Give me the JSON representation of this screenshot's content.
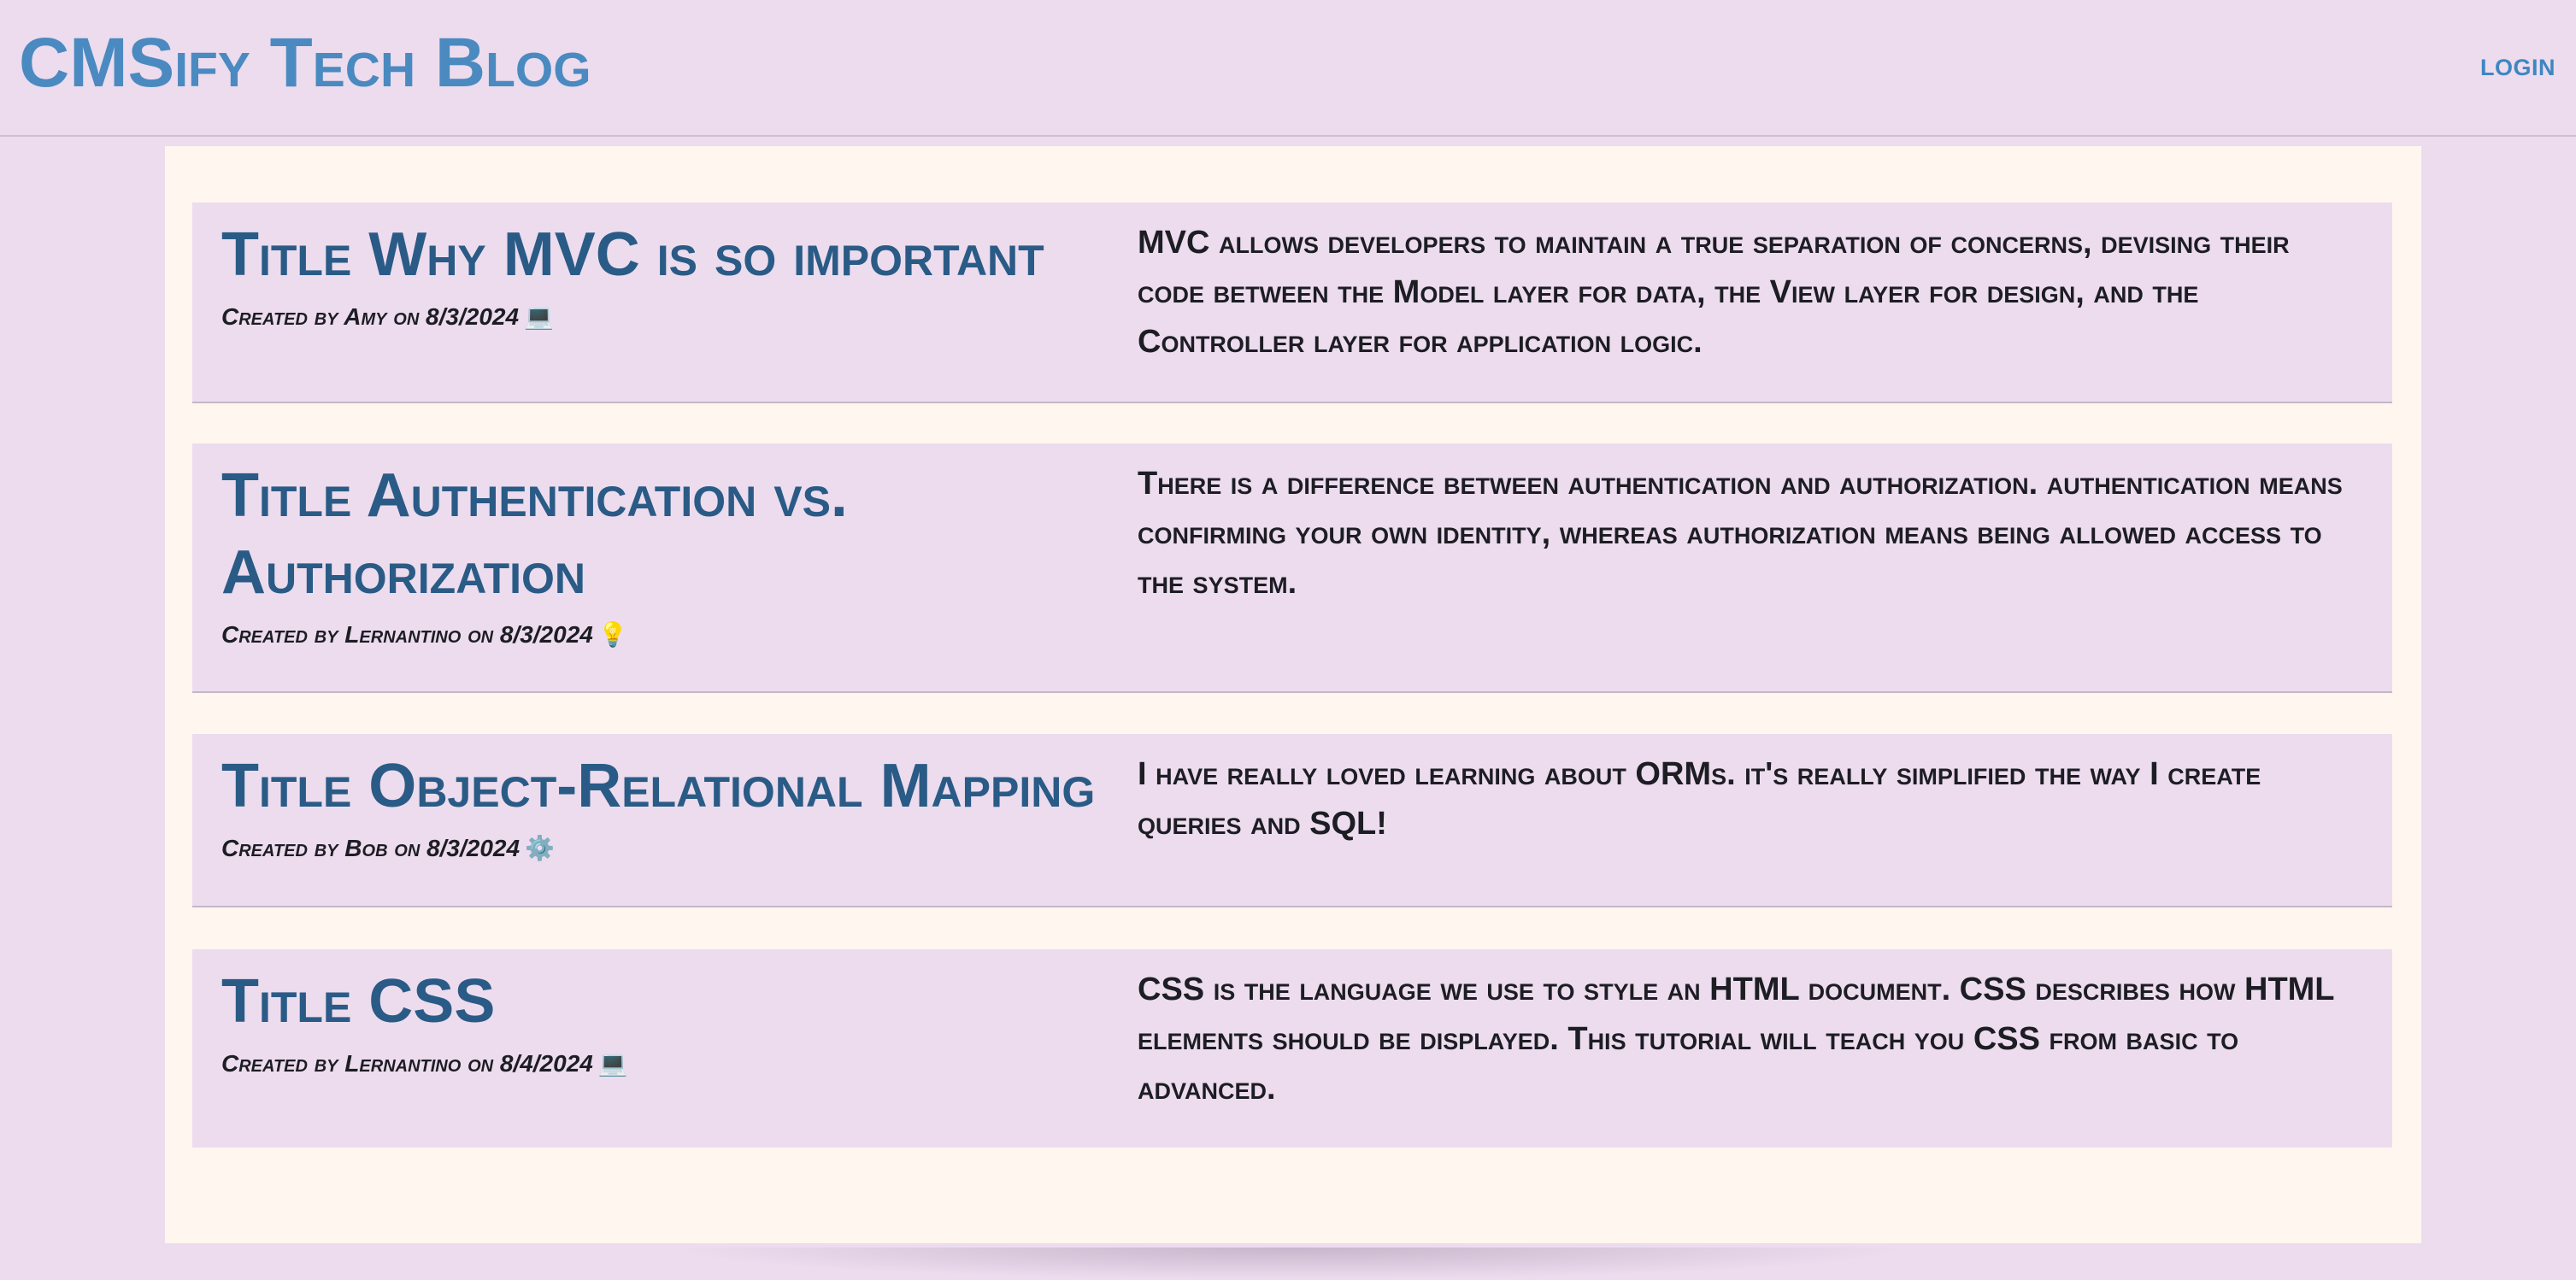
{
  "header": {
    "site_title": "CMSify Tech Blog",
    "login_label": "LOGIN"
  },
  "posts": [
    {
      "title": "Title Why MVC is so important",
      "meta": "Created by Amy on 8/3/2024",
      "emoji": "💻",
      "emoji_name": "laptop-icon",
      "body": "MVC allows developers to maintain a true separation of concerns, devising their code between the Model layer for data, the View layer for design, and the Controller layer for application logic."
    },
    {
      "title": "Title Authentication vs. Authorization",
      "meta": "Created by Lernantino on 8/3/2024",
      "emoji": "💡",
      "emoji_name": "lightbulb-icon",
      "body": "There is a difference between authentication and authorization. authentication means confirming your own identity, whereas authorization means being allowed access to the system."
    },
    {
      "title": "Title Object-Relational Mapping",
      "meta": "Created by Bob on 8/3/2024",
      "emoji": "⚙️",
      "emoji_name": "gear-icon",
      "body": "I have really loved learning about ORMs. it's really simplified the way I create queries and SQL!"
    },
    {
      "title": "Title CSS",
      "meta": "Created by Lernantino on 8/4/2024",
      "emoji": "💻",
      "emoji_name": "laptop-icon",
      "body": "CSS is the language we use to style an HTML document. CSS describes how HTML elements should be displayed. This tutorial will teach you CSS from basic to advanced."
    }
  ]
}
